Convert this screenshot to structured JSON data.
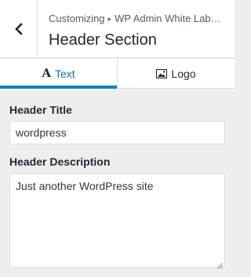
{
  "header": {
    "breadcrumb_root": "Customizing",
    "breadcrumb_separator": "▸",
    "breadcrumb_panel": "WP Admin White Lab…",
    "section_title": "Header Section",
    "back_icon": "chevron-left-icon"
  },
  "tabs": [
    {
      "label": "Text",
      "icon": "text-icon",
      "active": true
    },
    {
      "label": "Logo",
      "icon": "image-icon",
      "active": false
    }
  ],
  "fields": {
    "header_title": {
      "label": "Header Title",
      "value": "wordpress"
    },
    "header_description": {
      "label": "Header Description",
      "value": "Just another WordPress site"
    }
  },
  "colors": {
    "accent": "#0085ba",
    "active_tab_text": "#0073aa",
    "panel_background": "#eeeeee",
    "border": "#dddddd"
  }
}
